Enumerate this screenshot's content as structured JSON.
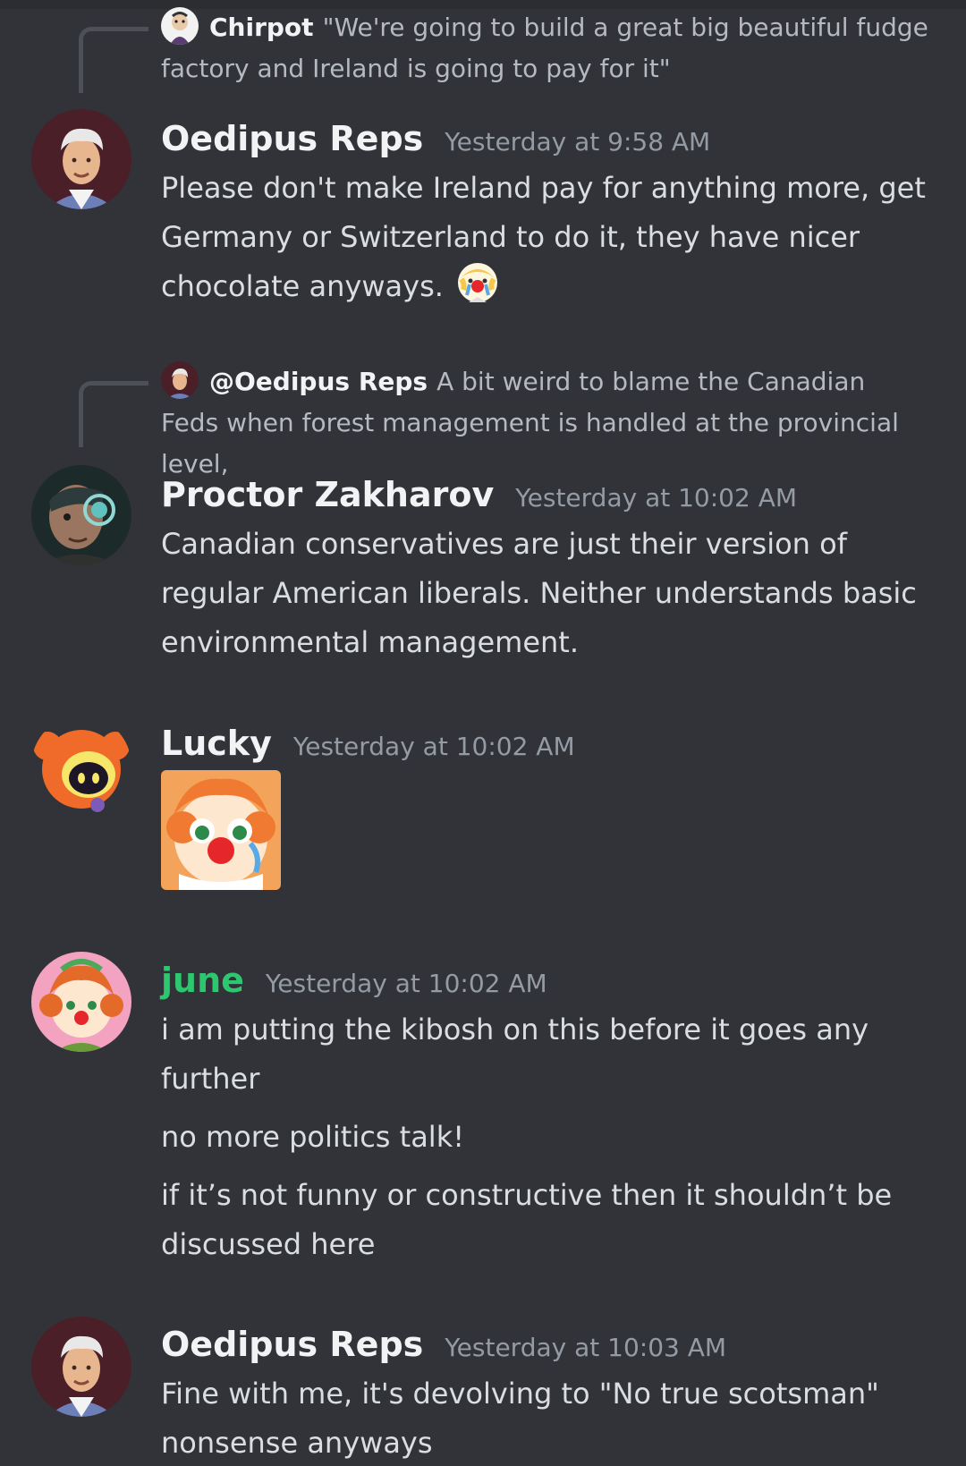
{
  "messages": [
    {
      "reply": {
        "author": "Chirpot",
        "text": "\"We're going to build a great big beautiful fudge factory and Ireland is going to pay for it\""
      },
      "author": "Oedipus Reps",
      "timestamp": "Yesterday at 9:58 AM",
      "text": "Please don't make Ireland pay for anything more, get Germany or Switzerland to do it, they have nicer chocolate anyways.",
      "emoji": "crying-clown-emoji"
    },
    {
      "reply": {
        "author": "@Oedipus Reps",
        "text": "A bit weird to blame the Canadian Feds when forest management is handled at the provincial level,"
      },
      "author": "Proctor Zakharov",
      "timestamp": "Yesterday at 10:02 AM",
      "text": "Canadian conservatives are just their version of regular American liberals. Neither understands basic environmental management."
    },
    {
      "author": "Lucky",
      "timestamp": "Yesterday at 10:02 AM",
      "sticker": "crying-clown-sticker"
    },
    {
      "author": "june",
      "author_color": "#2dc770",
      "timestamp": "Yesterday at 10:02 AM",
      "paragraphs": [
        "i am putting the kibosh on this before it goes any further",
        "no more politics talk!",
        "if it’s not funny or constructive then it shouldn’t be discussed here"
      ]
    },
    {
      "author": "Oedipus Reps",
      "timestamp": "Yesterday at 10:03 AM",
      "text": "Fine with me, it's devolving to \"No true scotsman\" nonsense anyways"
    }
  ]
}
